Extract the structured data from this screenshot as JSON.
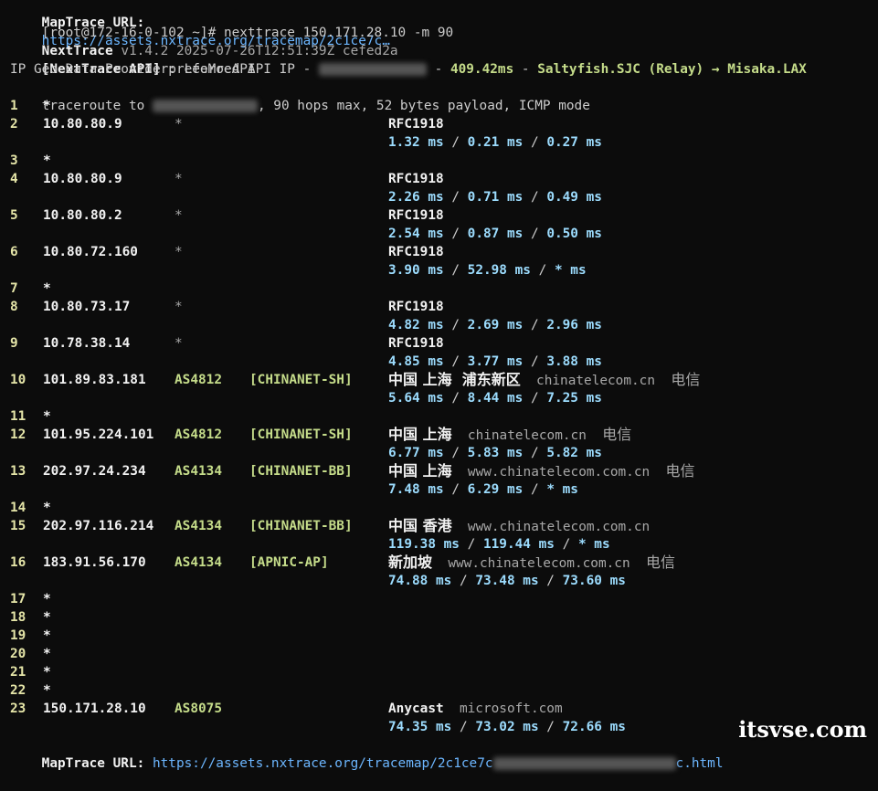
{
  "header": {
    "prompt_prefix": "[root@172-16-0-102 ~]#",
    "command": "nexttrace 150.171.28.10 -m 90",
    "app_name": "NextTrace",
    "version_info": "v1.4.2 2025-07-26T12:51:39Z cefed2a",
    "api_label": "[NextTrace API]",
    "api_text": "preferred API IP -",
    "api_sep1": "-",
    "api_latency": "409.42ms",
    "api_sep2": "-",
    "api_route": "Saltyfish.SJC (Relay) → Misaka.LAX",
    "geo_provider": "IP Geo Data Provider: LeoMoeAPI",
    "traceroute_prefix": "traceroute to",
    "traceroute_suffix": ", 90 hops max, 52 bytes payload, ICMP mode"
  },
  "hops": [
    {
      "n": "1",
      "star": "*"
    },
    {
      "n": "2",
      "ip": "10.80.80.9",
      "mark": "*",
      "geo": "RFC1918",
      "times": [
        "1.32 ms",
        "0.21 ms",
        "0.27 ms"
      ]
    },
    {
      "n": "3",
      "star": "*"
    },
    {
      "n": "4",
      "ip": "10.80.80.9",
      "mark": "*",
      "geo": "RFC1918",
      "times": [
        "2.26 ms",
        "0.71 ms",
        "0.49 ms"
      ]
    },
    {
      "n": "5",
      "ip": "10.80.80.2",
      "mark": "*",
      "geo": "RFC1918",
      "times": [
        "2.54 ms",
        "0.87 ms",
        "0.50 ms"
      ]
    },
    {
      "n": "6",
      "ip": "10.80.72.160",
      "mark": "*",
      "geo": "RFC1918",
      "times": [
        "3.90 ms",
        "52.98 ms",
        "* ms"
      ]
    },
    {
      "n": "7",
      "star": "*"
    },
    {
      "n": "8",
      "ip": "10.80.73.17",
      "mark": "*",
      "geo": "RFC1918",
      "times": [
        "4.82 ms",
        "2.69 ms",
        "2.96 ms"
      ]
    },
    {
      "n": "9",
      "ip": "10.78.38.14",
      "mark": "*",
      "geo": "RFC1918",
      "times": [
        "4.85 ms",
        "3.77 ms",
        "3.88 ms"
      ]
    },
    {
      "n": "10",
      "ip": "101.89.83.181",
      "as": "AS4812",
      "tag": "[CHINANET-SH]",
      "geo": "中国 上海  浦东新区",
      "domain": "chinatelecom.cn",
      "isp": "电信",
      "times": [
        "5.64 ms",
        "8.44 ms",
        "7.25 ms"
      ]
    },
    {
      "n": "11",
      "star": "*"
    },
    {
      "n": "12",
      "ip": "101.95.224.101",
      "as": "AS4812",
      "tag": "[CHINANET-SH]",
      "geo": "中国 上海",
      "domain": "chinatelecom.cn",
      "isp": "电信",
      "times": [
        "6.77 ms",
        "5.83 ms",
        "5.82 ms"
      ]
    },
    {
      "n": "13",
      "ip": "202.97.24.234",
      "as": "AS4134",
      "tag": "[CHINANET-BB]",
      "geo": "中国 上海",
      "domain": "www.chinatelecom.com.cn",
      "isp": "电信",
      "times": [
        "7.48 ms",
        "6.29 ms",
        "* ms"
      ]
    },
    {
      "n": "14",
      "star": "*"
    },
    {
      "n": "15",
      "ip": "202.97.116.214",
      "as": "AS4134",
      "tag": "[CHINANET-BB]",
      "geo": "中国 香港",
      "domain": "www.chinatelecom.com.cn",
      "isp": "",
      "times": [
        "119.38 ms",
        "119.44 ms",
        "* ms"
      ]
    },
    {
      "n": "16",
      "ip": "183.91.56.170",
      "as": "AS4134",
      "tag": "[APNIC-AP]",
      "geo": "新加坡",
      "domain": "www.chinatelecom.com.cn",
      "isp": "电信",
      "times": [
        "74.88 ms",
        "73.48 ms",
        "73.60 ms"
      ]
    },
    {
      "n": "17",
      "star": "*"
    },
    {
      "n": "18",
      "star": "*"
    },
    {
      "n": "19",
      "star": "*"
    },
    {
      "n": "20",
      "star": "*"
    },
    {
      "n": "21",
      "star": "*"
    },
    {
      "n": "22",
      "star": "*"
    },
    {
      "n": "23",
      "ip": "150.171.28.10",
      "as": "AS8075",
      "geo": "Anycast",
      "domain": "microsoft.com",
      "isp": "",
      "times": [
        "74.35 ms",
        "73.02 ms",
        "72.66 ms"
      ]
    }
  ],
  "footer": {
    "maptrace_label": "MapTrace URL:",
    "maptrace_url_start": "https://assets.nxtrace.org/tracemap/2c1ce7c",
    "maptrace_url_end": "c.html"
  },
  "watermark": "itsvse.com",
  "colors": {
    "background": "#0c0c0c",
    "green": "#c5dc8a",
    "cyan": "#9cdcfe",
    "yellow": "#e5e5a8",
    "link": "#6cb6ff"
  }
}
